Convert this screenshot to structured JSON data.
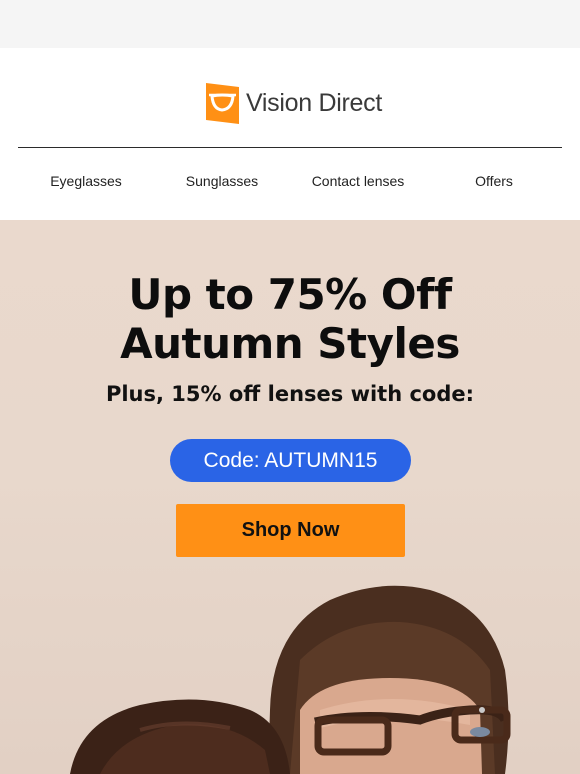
{
  "brand": {
    "name": "Vision Direct",
    "accent_color": "#ff9015"
  },
  "nav": {
    "items": [
      {
        "label": "Eyeglasses"
      },
      {
        "label": "Sunglasses"
      },
      {
        "label": "Contact lenses"
      },
      {
        "label": "Offers"
      }
    ]
  },
  "hero": {
    "headline_line1": "Up to 75% Off",
    "headline_line2": "Autumn Styles",
    "subline": "Plus, 15% off lenses with code:",
    "code_label": "Code: AUTUMN15",
    "code_color": "#2a64e6",
    "cta_label": "Shop Now",
    "photo_icon": "models-wearing-glasses-photo"
  }
}
